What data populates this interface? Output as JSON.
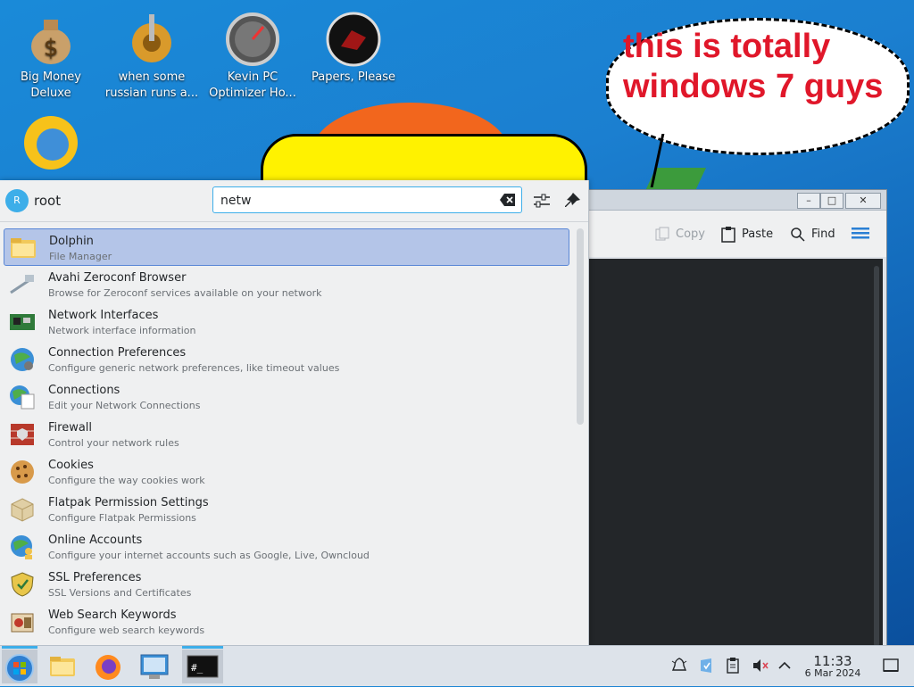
{
  "desktop": {
    "icons": [
      {
        "label": "Big Money\nDeluxe",
        "icon": "money-bag-icon"
      },
      {
        "label": "when some\nrussian runs a...",
        "icon": "gear-icon"
      },
      {
        "label": "Kevin PC\nOptimizer Ho...",
        "icon": "speedometer-icon"
      },
      {
        "label": "Papers, Please",
        "icon": "papers-please-icon"
      },
      {
        "label": "",
        "icon": "sun-globe-icon"
      }
    ],
    "speech_bubble_text": "this is totally windows 7 guys"
  },
  "konsole": {
    "minimize": "–",
    "maximize": "□",
    "close": "✕",
    "copy_label": "Copy",
    "paste_label": "Paste",
    "find_label": "Find"
  },
  "launcher": {
    "user_initial": "R",
    "username": "root",
    "search_value": "netw",
    "results": [
      {
        "name": "Dolphin",
        "desc": "File Manager",
        "icon": "folder-icon"
      },
      {
        "name": "Avahi Zeroconf Browser",
        "desc": "Browse for Zeroconf services available on your network",
        "icon": "network-cable-icon"
      },
      {
        "name": "Network Interfaces",
        "desc": "Network interface information",
        "icon": "network-card-icon"
      },
      {
        "name": "Connection Preferences",
        "desc": "Configure generic network preferences, like timeout values",
        "icon": "globe-gear-icon"
      },
      {
        "name": "Connections",
        "desc": "Edit your Network Connections",
        "icon": "globe-doc-icon"
      },
      {
        "name": "Firewall",
        "desc": "Control your network rules",
        "icon": "firewall-icon"
      },
      {
        "name": "Cookies",
        "desc": "Configure the way cookies work",
        "icon": "cookie-icon"
      },
      {
        "name": "Flatpak Permission Settings",
        "desc": "Configure Flatpak Permissions",
        "icon": "package-icon"
      },
      {
        "name": "Online Accounts",
        "desc": "Configure your internet accounts such as Google, Live, Owncloud",
        "icon": "globe-user-icon"
      },
      {
        "name": "SSL Preferences",
        "desc": "SSL Versions and Certificates",
        "icon": "ssl-shield-icon"
      },
      {
        "name": "Web Search Keywords",
        "desc": "Configure web search keywords",
        "icon": "web-keywords-icon"
      }
    ]
  },
  "taskbar": {
    "terminal_label": "#_",
    "clock_time": "11:33",
    "clock_date": "6 Mar 2024"
  },
  "colors": {
    "accent": "#3daee9",
    "selection": "#b4c5e8",
    "bubble_text": "#e0172a"
  }
}
